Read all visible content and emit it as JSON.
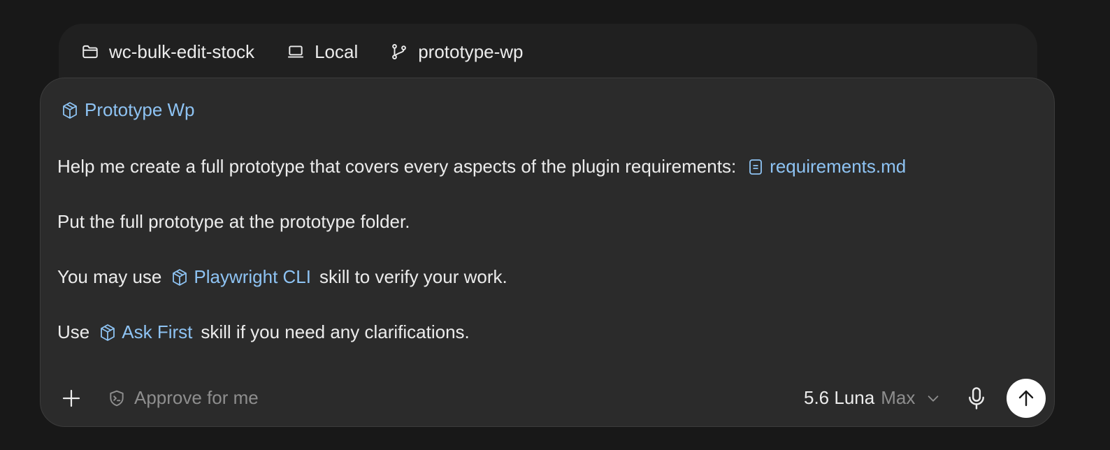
{
  "context_bar": {
    "folder_icon": "folder-icon",
    "folder_label": "wc-bulk-edit-stock",
    "env_icon": "laptop-icon",
    "env_label": "Local",
    "branch_icon": "git-branch-icon",
    "branch_label": "prototype-wp"
  },
  "composer": {
    "skill_chip": {
      "icon": "cube-icon",
      "label": "Prototype Wp"
    },
    "line1": {
      "text": "Help me create a full prototype that covers every aspects of the plugin requirements:",
      "file_icon": "document-icon",
      "file_label": "requirements.md"
    },
    "line2": {
      "text": "Put the full prototype at the prototype folder."
    },
    "line3": {
      "before": "You may use",
      "chip_icon": "cube-icon",
      "chip_label": "Playwright CLI",
      "after": "skill to verify your work."
    },
    "line4": {
      "before": "Use",
      "chip_icon": "cube-icon",
      "chip_label": "Ask First",
      "after": "skill if you need any clarifications."
    }
  },
  "bottom_bar": {
    "add_icon": "plus-icon",
    "approve_icon": "shield-terminal-icon",
    "approve_placeholder": "Approve for me",
    "model_name": "5.6 Luna",
    "model_mode": "Max",
    "dropdown_icon": "chevron-down-icon",
    "mic_icon": "microphone-icon",
    "send_icon": "arrow-up-icon"
  },
  "colors": {
    "background": "#181818",
    "composer_bg": "#2b2b2b",
    "link_accent": "#8ec3f3",
    "muted_text": "#8e8e8e"
  }
}
